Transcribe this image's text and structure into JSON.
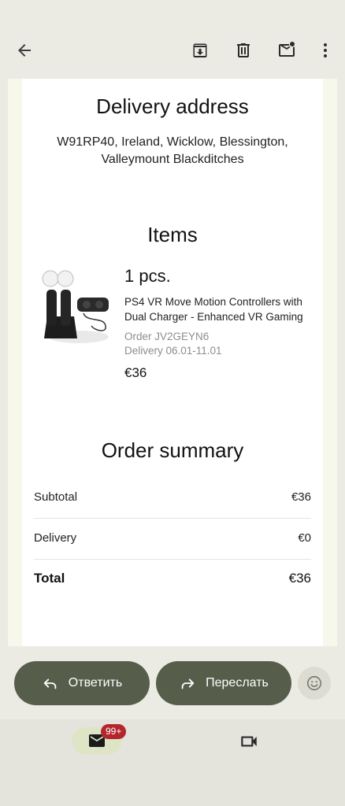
{
  "toolbar": {
    "back_icon": "arrow-left-icon",
    "archive_icon": "archive-icon",
    "delete_icon": "trash-icon",
    "mark_unread_icon": "mail-unread-icon",
    "more_icon": "more-vert-icon"
  },
  "email": {
    "delivery": {
      "heading": "Delivery address",
      "address_line1": "W91RP40, Ireland, Wicklow, Blessington,",
      "address_line2": "Valleymount Blackditches"
    },
    "items": {
      "heading": "Items",
      "list": [
        {
          "quantity": "1 pcs.",
          "name_line1": "PS4 VR Move Motion Controllers with",
          "name_line2": "Dual Charger - Enhanced VR Gaming",
          "order": "Order JV2GEYN6",
          "delivery": "Delivery 06.01-11.01",
          "price": "€36"
        }
      ]
    },
    "summary": {
      "heading": "Order summary",
      "subtotal_label": "Subtotal",
      "subtotal_value": "€36",
      "delivery_label": "Delivery",
      "delivery_value": "€0",
      "total_label": "Total",
      "total_value": "€36"
    }
  },
  "actions": {
    "reply_label": "Ответить",
    "forward_label": "Переслать",
    "emoji_icon": "emoji-smile-icon"
  },
  "bottom_nav": {
    "mail_icon": "mail-icon",
    "mail_badge": "99+",
    "video_icon": "videocam-icon"
  },
  "colors": {
    "background": "#ebebe3",
    "pill": "#565e4b",
    "badge": "#b3262d",
    "nav_active": "#dde5c6"
  }
}
